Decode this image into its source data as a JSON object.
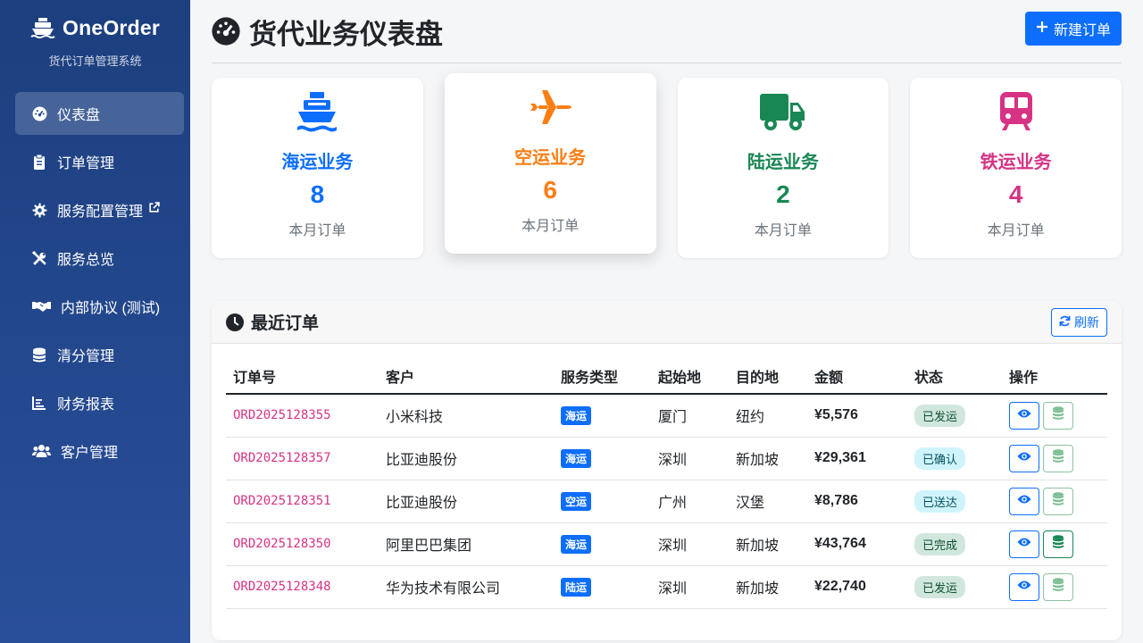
{
  "app": {
    "name": "OneOrder",
    "subtitle": "货代订单管理系统"
  },
  "sidebar": {
    "items": [
      {
        "label": "仪表盘",
        "icon": "dashboard-icon",
        "active": true
      },
      {
        "label": "订单管理",
        "icon": "clipboard-icon"
      },
      {
        "label": "服务配置管理",
        "icon": "gear-icon",
        "external": true
      },
      {
        "label": "服务总览",
        "icon": "tools-icon"
      },
      {
        "label": "内部协议 (测试)",
        "icon": "handshake-icon"
      },
      {
        "label": "清分管理",
        "icon": "coins-icon"
      },
      {
        "label": "财务报表",
        "icon": "chart-icon"
      },
      {
        "label": "客户管理",
        "icon": "users-icon"
      }
    ]
  },
  "header": {
    "title": "货代业务仪表盘",
    "new_button": "新建订单"
  },
  "cards": [
    {
      "title": "海运业务",
      "count": "8",
      "sub": "本月订单",
      "color": "#0d6efd",
      "icon": "ship-icon"
    },
    {
      "title": "空运业务",
      "count": "6",
      "sub": "本月订单",
      "color": "#fd7e14",
      "icon": "plane-icon"
    },
    {
      "title": "陆运业务",
      "count": "2",
      "sub": "本月订单",
      "color": "#198754",
      "icon": "truck-icon"
    },
    {
      "title": "铁运业务",
      "count": "4",
      "sub": "本月订单",
      "color": "#d63384",
      "icon": "train-icon"
    }
  ],
  "orders": {
    "title": "最近订单",
    "refresh": "刷新",
    "columns": [
      "订单号",
      "客户",
      "服务类型",
      "起始地",
      "目的地",
      "金额",
      "状态",
      "操作"
    ],
    "rows": [
      {
        "no": "ORD2025128355",
        "customer": "小米科技",
        "service": "海运",
        "from": "厦门",
        "to": "纽约",
        "amount": "¥5,576",
        "status": "已发运",
        "status_color": "green"
      },
      {
        "no": "ORD2025128357",
        "customer": "比亚迪股份",
        "service": "海运",
        "from": "深圳",
        "to": "新加坡",
        "amount": "¥29,361",
        "status": "已确认",
        "status_color": "blue"
      },
      {
        "no": "ORD2025128351",
        "customer": "比亚迪股份",
        "service": "空运",
        "from": "广州",
        "to": "汉堡",
        "amount": "¥8,786",
        "status": "已送达",
        "status_color": "blue"
      },
      {
        "no": "ORD2025128350",
        "customer": "阿里巴巴集团",
        "service": "海运",
        "from": "深圳",
        "to": "新加坡",
        "amount": "¥43,764",
        "status": "已完成",
        "status_color": "green"
      },
      {
        "no": "ORD2025128348",
        "customer": "华为技术有限公司",
        "service": "陆运",
        "from": "深圳",
        "to": "新加坡",
        "amount": "¥22,740",
        "status": "已发运",
        "status_color": "green"
      }
    ]
  }
}
